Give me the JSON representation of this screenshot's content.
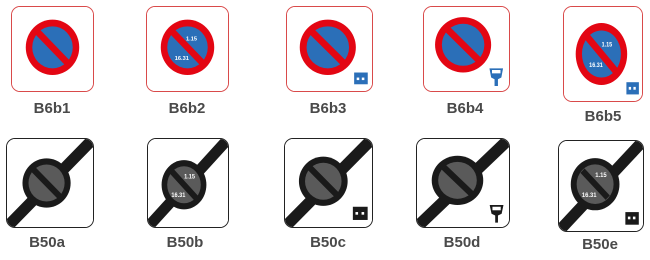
{
  "colors": {
    "ring_red": "#e30613",
    "field_blue": "#2b6fb8",
    "end_black": "#1a1a1a",
    "label_gray": "#4a4a4a"
  },
  "signs": [
    {
      "code": "B6b1",
      "family": "prohibition",
      "panel": "none"
    },
    {
      "code": "B6b2",
      "family": "prohibition",
      "panel": "none",
      "times": [
        "1.15",
        "16.31"
      ]
    },
    {
      "code": "B6b3",
      "family": "prohibition",
      "panel": "disc-icon"
    },
    {
      "code": "B6b4",
      "family": "prohibition",
      "panel": "meter-icon"
    },
    {
      "code": "B6b5",
      "family": "prohibition",
      "panel": "disc-icon",
      "times": [
        "1.15",
        "16.31"
      ]
    },
    {
      "code": "B50a",
      "family": "end",
      "panel": "none"
    },
    {
      "code": "B50b",
      "family": "end",
      "panel": "none",
      "times": [
        "1.15",
        "16.31"
      ]
    },
    {
      "code": "B50c",
      "family": "end",
      "panel": "disc-icon"
    },
    {
      "code": "B50d",
      "family": "end",
      "panel": "meter-icon"
    },
    {
      "code": "B50e",
      "family": "end",
      "panel": "disc-icon",
      "times": [
        "1.15",
        "16.31"
      ]
    }
  ]
}
